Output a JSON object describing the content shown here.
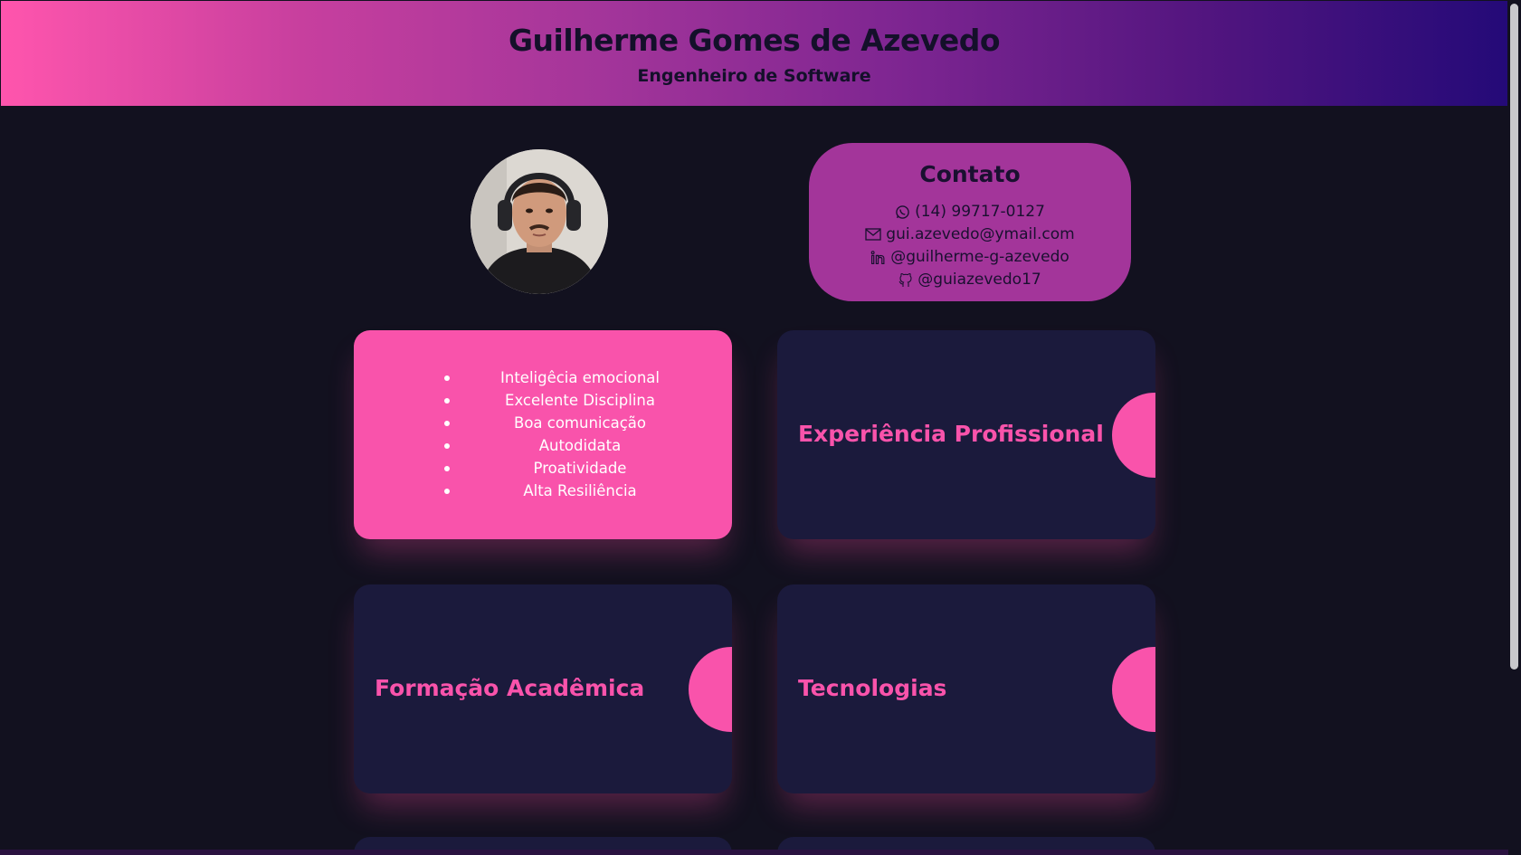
{
  "header": {
    "name": "Guilherme Gomes de Azevedo",
    "role": "Engenheiro de Software"
  },
  "contact": {
    "title": "Contato",
    "phone": "(14) 99717-0127",
    "email": "gui.azevedo@ymail.com",
    "linkedin": "@guilherme-g-azevedo",
    "github": "@guiazevedo17"
  },
  "soft_skills": [
    "Inteligêcia emocional",
    "Excelente Disciplina",
    "Boa comunicação",
    "Autodidata",
    "Proatividade",
    "Alta Resiliência"
  ],
  "sections": {
    "experience": "Experiência Profissional",
    "education": "Formação Acadêmica",
    "technologies": "Tecnologias"
  },
  "colors": {
    "background": "#12111f",
    "accent_pink": "#f953ab",
    "card_navy": "#1b1a3c",
    "contact_purple": "#a3359a",
    "header_gradient_start": "#ff55ad",
    "header_gradient_end": "#240a78"
  },
  "icons": {
    "phone": "whatsapp-icon",
    "email": "mail-icon",
    "linkedin": "linkedin-icon",
    "github": "github-icon"
  }
}
